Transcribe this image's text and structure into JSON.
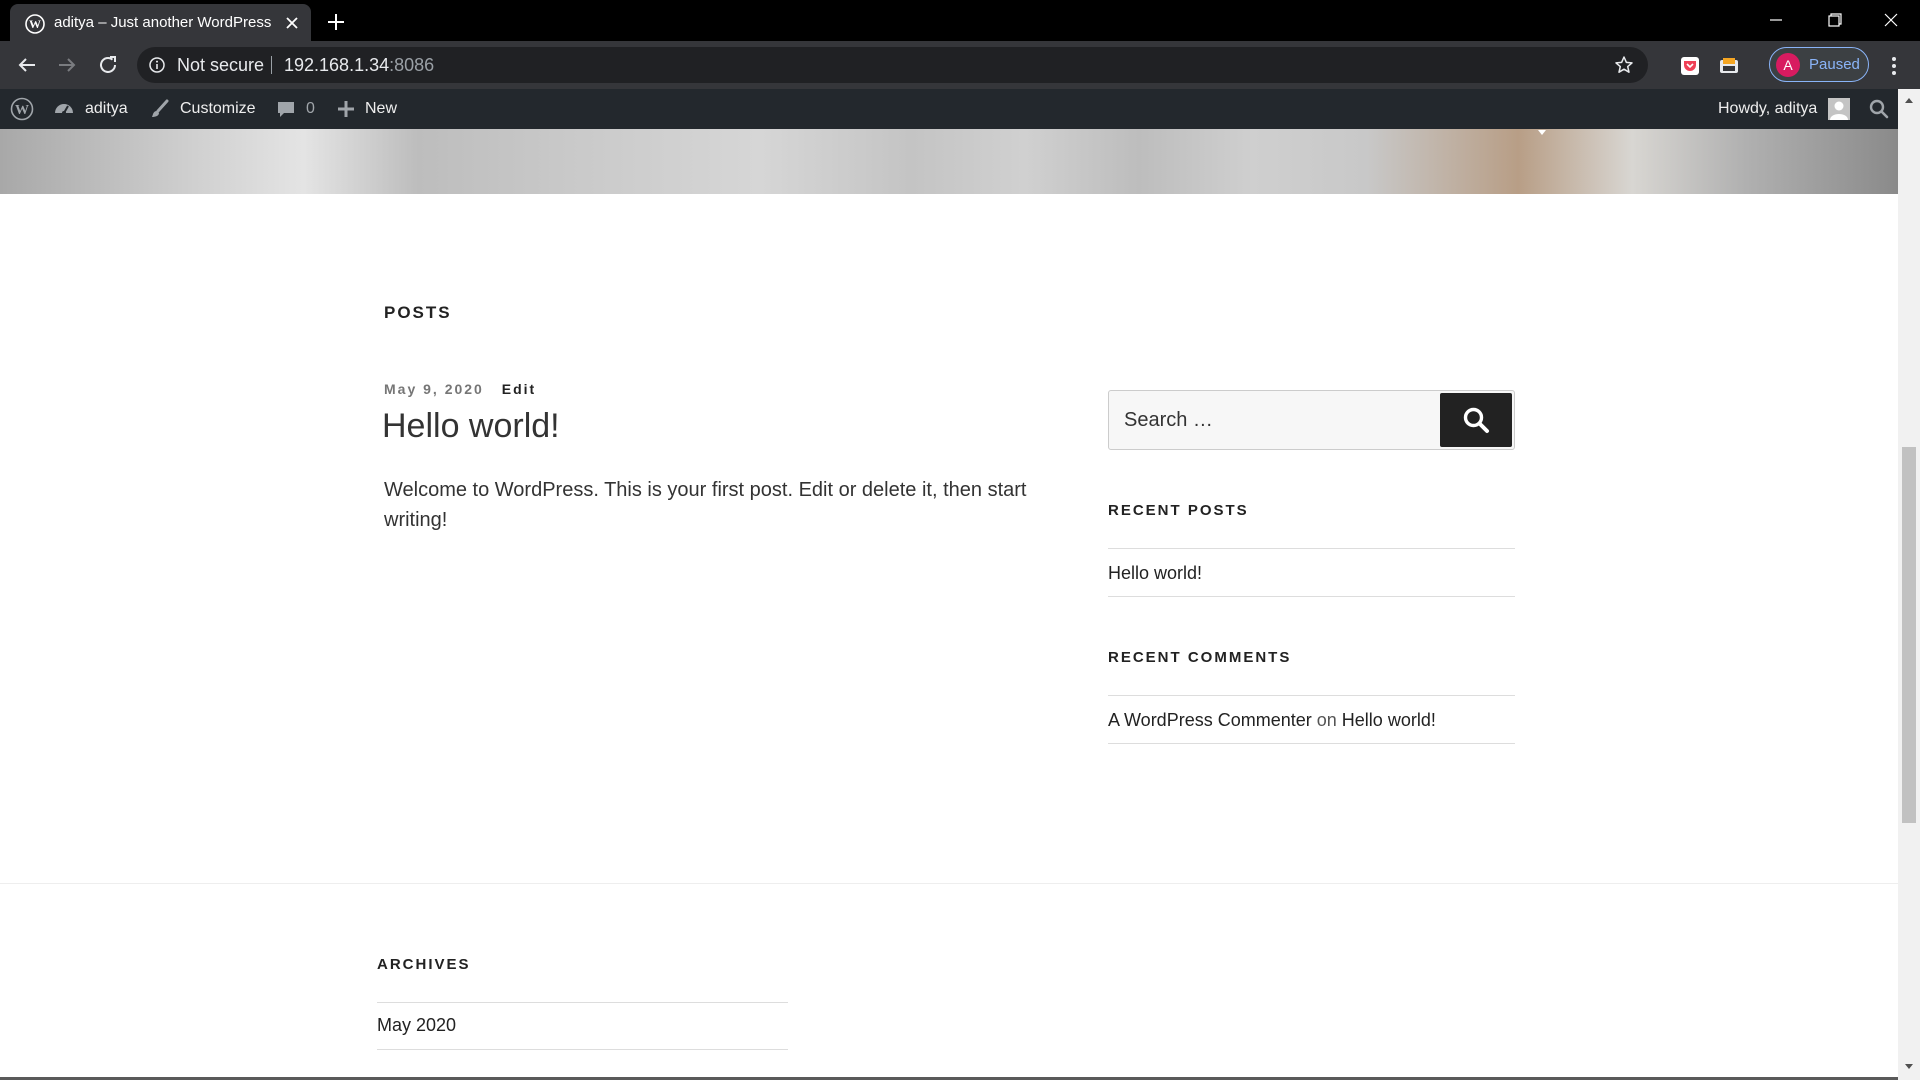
{
  "browser": {
    "tab": {
      "title": "aditya – Just another WordPress site"
    },
    "omnibox": {
      "security_label": "Not secure",
      "host": "192.168.1.34",
      "port": ":8086"
    },
    "profile": {
      "initial": "A",
      "status": "Paused"
    }
  },
  "adminbar": {
    "site_name": "aditya",
    "customize_label": "Customize",
    "comments_count": "0",
    "new_label": "New",
    "greeting": "Howdy, aditya"
  },
  "main": {
    "posts_heading": "Posts",
    "post": {
      "date": "May 9, 2020",
      "edit_label": "Edit",
      "title": "Hello world!",
      "excerpt": "Welcome to WordPress. This is your first post. Edit or delete it, then start writing!"
    }
  },
  "sidebar": {
    "search_placeholder": "Search …",
    "recent_posts_title": "Recent Posts",
    "recent_posts": [
      "Hello world!"
    ],
    "recent_comments_title": "Recent Comments",
    "recent_comment": {
      "author": "A WordPress Commenter",
      "connector": "on",
      "post": "Hello world!"
    }
  },
  "footer": {
    "archives_title": "Archives",
    "archives": [
      "May 2020"
    ]
  },
  "colors": {
    "admin_bar": "#23282d",
    "browser_frame": "#000000",
    "toolbar": "#35363a",
    "accent_profile": "#8ab4f8"
  }
}
